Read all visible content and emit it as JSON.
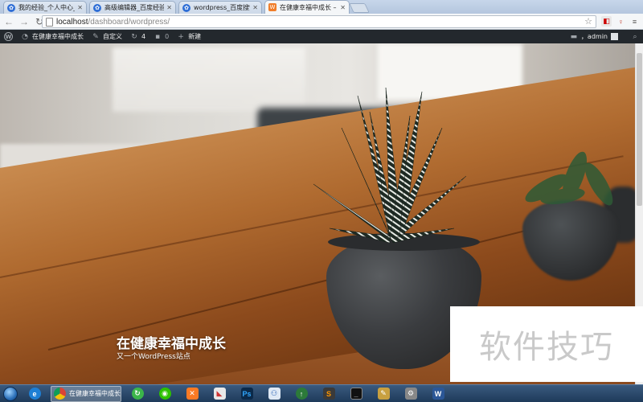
{
  "browser": {
    "tabs": [
      {
        "title": "我的经验_个人中心_百度",
        "icon": "baidu-icon",
        "active": false
      },
      {
        "title": "高级编辑器_百度经验",
        "icon": "baidu-icon",
        "active": false
      },
      {
        "title": "wordpress_百度搜索",
        "icon": "baidu-icon",
        "active": false
      },
      {
        "title": "在健康幸福中成长 – 又",
        "icon": "wordpress-icon",
        "active": true
      }
    ],
    "url_host": "localhost",
    "url_path": "/dashboard/wordpress/"
  },
  "admin_bar": {
    "site_name": "在健康幸福中成长",
    "customize": "自定义",
    "updates_count": "4",
    "comments_count": "0",
    "new_label": "新建",
    "greeting": "，admin"
  },
  "site": {
    "title": "在健康幸福中成长",
    "description": "又一个WordPress站点"
  },
  "taskbar": {
    "active_label": "在健康幸福中成长"
  },
  "watermark": "软件技巧"
}
